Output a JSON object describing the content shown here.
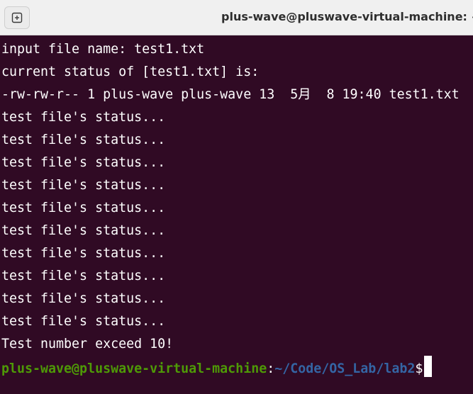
{
  "window": {
    "title": "plus-wave@pluswave-virtual-machine: ~/"
  },
  "icons": {
    "new_tab": "new-tab-icon"
  },
  "output": [
    "input file name: test1.txt",
    "current status of [test1.txt] is:",
    "-rw-rw-r-- 1 plus-wave plus-wave 13  5月  8 19:40 test1.txt",
    "test file's status...",
    "test file's status...",
    "test file's status...",
    "test file's status...",
    "test file's status...",
    "test file's status...",
    "test file's status...",
    "test file's status...",
    "test file's status...",
    "test file's status...",
    "Test number exceed 10!"
  ],
  "prompt": {
    "user_host": "plus-wave@pluswave-virtual-machine",
    "separator": ":",
    "path": "~/Code/OS_Lab/lab2",
    "symbol": "$"
  },
  "colors": {
    "background": "#300a24",
    "prompt_user": "#4e9a06",
    "prompt_path": "#3465a4",
    "text": "#ffffff"
  }
}
